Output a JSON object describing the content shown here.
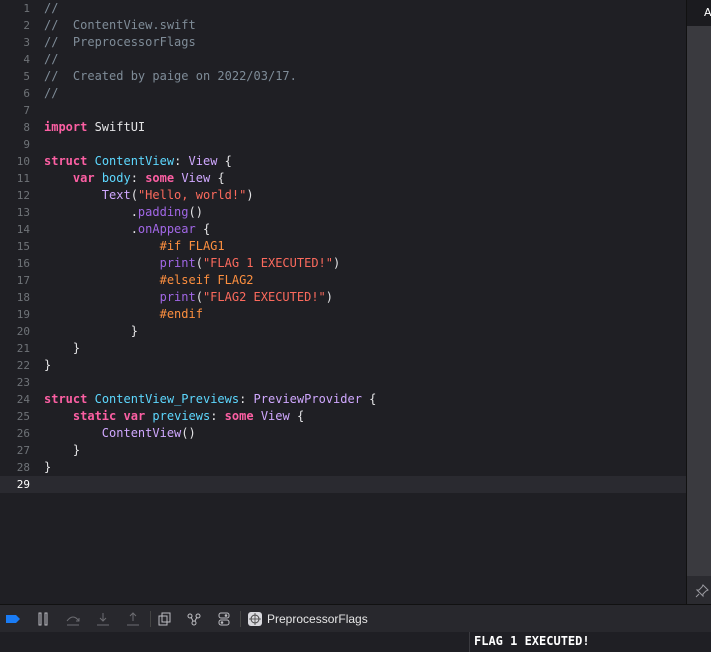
{
  "editor": {
    "current_line": 29,
    "lines": [
      {
        "n": "1",
        "tokens": [
          {
            "t": "//",
            "c": "comment"
          }
        ]
      },
      {
        "n": "2",
        "tokens": [
          {
            "t": "//  ContentView.swift",
            "c": "comment"
          }
        ]
      },
      {
        "n": "3",
        "tokens": [
          {
            "t": "//  PreprocessorFlags",
            "c": "comment"
          }
        ]
      },
      {
        "n": "4",
        "tokens": [
          {
            "t": "//",
            "c": "comment"
          }
        ]
      },
      {
        "n": "5",
        "tokens": [
          {
            "t": "//  Created by paige on 2022/03/17.",
            "c": "comment"
          }
        ]
      },
      {
        "n": "6",
        "tokens": [
          {
            "t": "//",
            "c": "comment"
          }
        ]
      },
      {
        "n": "7",
        "tokens": []
      },
      {
        "n": "8",
        "tokens": [
          {
            "t": "import",
            "c": "kw"
          },
          {
            "t": " SwiftUI",
            "c": "plain"
          }
        ]
      },
      {
        "n": "9",
        "tokens": []
      },
      {
        "n": "10",
        "tokens": [
          {
            "t": "struct",
            "c": "kw"
          },
          {
            "t": " ",
            "c": "plain"
          },
          {
            "t": "ContentView",
            "c": "decl"
          },
          {
            "t": ": ",
            "c": "plain"
          },
          {
            "t": "View",
            "c": "type"
          },
          {
            "t": " {",
            "c": "plain"
          }
        ]
      },
      {
        "n": "11",
        "tokens": [
          {
            "t": "    ",
            "c": "plain"
          },
          {
            "t": "var",
            "c": "kw"
          },
          {
            "t": " ",
            "c": "plain"
          },
          {
            "t": "body",
            "c": "decl"
          },
          {
            "t": ": ",
            "c": "plain"
          },
          {
            "t": "some",
            "c": "kw"
          },
          {
            "t": " ",
            "c": "plain"
          },
          {
            "t": "View",
            "c": "type"
          },
          {
            "t": " {",
            "c": "plain"
          }
        ]
      },
      {
        "n": "12",
        "tokens": [
          {
            "t": "        ",
            "c": "plain"
          },
          {
            "t": "Text",
            "c": "type"
          },
          {
            "t": "(",
            "c": "plain"
          },
          {
            "t": "\"Hello, world!\"",
            "c": "str"
          },
          {
            "t": ")",
            "c": "plain"
          }
        ]
      },
      {
        "n": "13",
        "tokens": [
          {
            "t": "            .",
            "c": "plain"
          },
          {
            "t": "padding",
            "c": "fn"
          },
          {
            "t": "()",
            "c": "plain"
          }
        ]
      },
      {
        "n": "14",
        "tokens": [
          {
            "t": "            .",
            "c": "plain"
          },
          {
            "t": "onAppear",
            "c": "fn"
          },
          {
            "t": " {",
            "c": "plain"
          }
        ]
      },
      {
        "n": "15",
        "tokens": [
          {
            "t": "                ",
            "c": "plain"
          },
          {
            "t": "#if FLAG1",
            "c": "pre"
          }
        ]
      },
      {
        "n": "16",
        "tokens": [
          {
            "t": "                ",
            "c": "plain"
          },
          {
            "t": "print",
            "c": "fn"
          },
          {
            "t": "(",
            "c": "plain"
          },
          {
            "t": "\"FLAG 1 EXECUTED!\"",
            "c": "str"
          },
          {
            "t": ")",
            "c": "plain"
          }
        ]
      },
      {
        "n": "17",
        "tokens": [
          {
            "t": "                ",
            "c": "plain"
          },
          {
            "t": "#elseif FLAG2",
            "c": "pre"
          }
        ]
      },
      {
        "n": "18",
        "tokens": [
          {
            "t": "                ",
            "c": "plain"
          },
          {
            "t": "print",
            "c": "fn"
          },
          {
            "t": "(",
            "c": "plain"
          },
          {
            "t": "\"FLAG2 EXECUTED!\"",
            "c": "str"
          },
          {
            "t": ")",
            "c": "plain"
          }
        ]
      },
      {
        "n": "19",
        "tokens": [
          {
            "t": "                ",
            "c": "plain"
          },
          {
            "t": "#endif",
            "c": "pre"
          }
        ]
      },
      {
        "n": "20",
        "tokens": [
          {
            "t": "            }",
            "c": "plain"
          }
        ]
      },
      {
        "n": "21",
        "tokens": [
          {
            "t": "    }",
            "c": "plain"
          }
        ]
      },
      {
        "n": "22",
        "tokens": [
          {
            "t": "}",
            "c": "plain"
          }
        ]
      },
      {
        "n": "23",
        "tokens": []
      },
      {
        "n": "24",
        "tokens": [
          {
            "t": "struct",
            "c": "kw"
          },
          {
            "t": " ",
            "c": "plain"
          },
          {
            "t": "ContentView_Previews",
            "c": "decl"
          },
          {
            "t": ": ",
            "c": "plain"
          },
          {
            "t": "PreviewProvider",
            "c": "type"
          },
          {
            "t": " {",
            "c": "plain"
          }
        ]
      },
      {
        "n": "25",
        "tokens": [
          {
            "t": "    ",
            "c": "plain"
          },
          {
            "t": "static",
            "c": "kw"
          },
          {
            "t": " ",
            "c": "plain"
          },
          {
            "t": "var",
            "c": "kw"
          },
          {
            "t": " ",
            "c": "plain"
          },
          {
            "t": "previews",
            "c": "decl"
          },
          {
            "t": ": ",
            "c": "plain"
          },
          {
            "t": "some",
            "c": "kw"
          },
          {
            "t": " ",
            "c": "plain"
          },
          {
            "t": "View",
            "c": "type"
          },
          {
            "t": " {",
            "c": "plain"
          }
        ]
      },
      {
        "n": "26",
        "tokens": [
          {
            "t": "        ",
            "c": "plain"
          },
          {
            "t": "ContentView",
            "c": "type"
          },
          {
            "t": "()",
            "c": "plain"
          }
        ]
      },
      {
        "n": "27",
        "tokens": [
          {
            "t": "    }",
            "c": "plain"
          }
        ]
      },
      {
        "n": "28",
        "tokens": [
          {
            "t": "}",
            "c": "plain"
          }
        ]
      },
      {
        "n": "29",
        "tokens": []
      }
    ]
  },
  "right_panel": {
    "header_label": "A"
  },
  "debug_bar": {
    "buttons": [
      "breakpoints-toggle-icon",
      "pause-icon",
      "step-over-icon",
      "step-into-icon",
      "step-out-icon",
      "view-hierarchy-icon",
      "memory-graph-icon",
      "environment-overrides-icon"
    ],
    "scheme_name": "PreprocessorFlags"
  },
  "console": {
    "output": "FLAG 1 EXECUTED!"
  },
  "colors": {
    "comment": "#7f8c98",
    "keyword": "#fc5fa3",
    "string": "#fc6a5d",
    "type": "#d0a8ff",
    "declaration": "#5dd8ff",
    "function": "#a167e6",
    "preprocessor": "#fd8f3f",
    "accent": "#1a7cf5"
  }
}
